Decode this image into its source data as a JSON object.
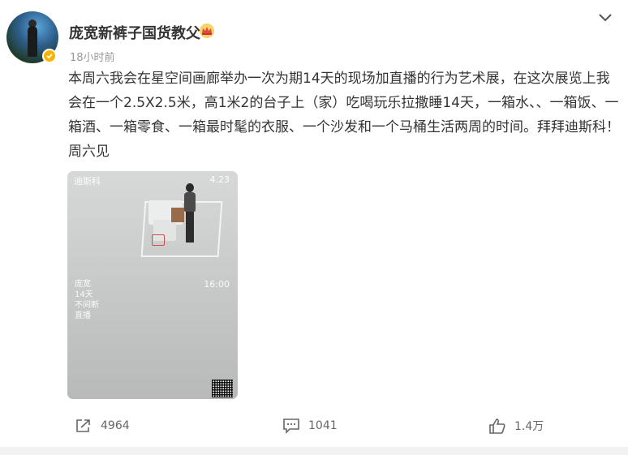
{
  "post": {
    "author": "庞宽新裤子国货教父",
    "timestamp": "18小时前",
    "text": "本周六我会在星空间画廊举办一次为期14天的现场加直播的行为艺术展，在这次展览上我会在一个2.5X2.5米，高1米2的台子上（家）吃喝玩乐拉撒睡14天，一箱水、、一箱饭、一箱酒、一箱零食、一箱最时髦的衣服、一个沙发和一个马桶生活两周的时间。拜拜迪斯科！周六见"
  },
  "media": {
    "overlay_top_left": "迪斯科",
    "overlay_top_right": "4.23",
    "overlay_time": "16:00",
    "overlay_left_lines": [
      "庞宽",
      "14天",
      "不间断",
      "直播"
    ]
  },
  "actions": {
    "repost_count": "4964",
    "comment_count": "1041",
    "like_count": "1.4万"
  },
  "icons": {
    "verify": "verified-badge-icon",
    "crown": "crown-icon",
    "chevron": "chevron-down-icon",
    "repost": "repost-icon",
    "comment": "comment-icon",
    "like": "thumbs-up-icon",
    "qr": "qr-code-icon"
  },
  "colors": {
    "verify": "#f7b500",
    "crown": "#e8a93a",
    "text": "#333333",
    "meta": "#999999"
  }
}
